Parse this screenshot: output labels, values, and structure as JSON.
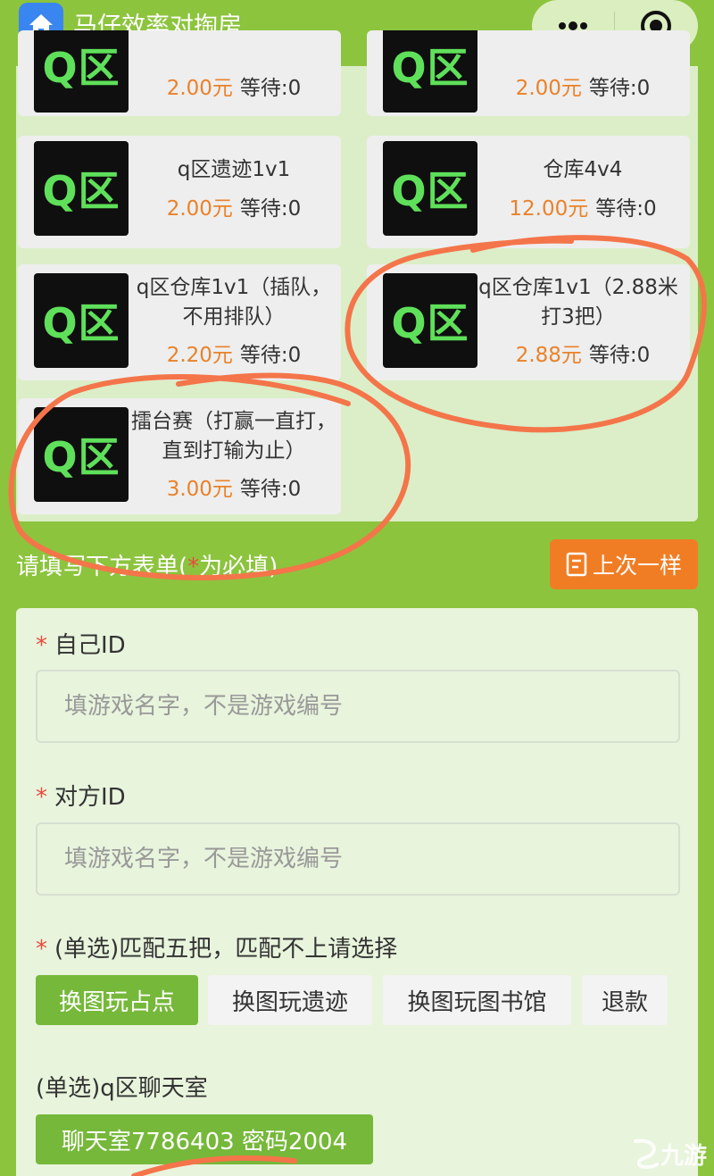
{
  "header": {
    "title": "马仔效率对掏房",
    "more_icon": "more-icon",
    "close_icon": "record-close-icon"
  },
  "products": [
    {
      "name": "",
      "price": "2.00元",
      "wait": "等待:0",
      "thumb": "Q区"
    },
    {
      "name": "",
      "price": "2.00元",
      "wait": "等待:0",
      "thumb": "Q区"
    },
    {
      "name": "q区遗迹1v1",
      "price": "2.00元",
      "wait": "等待:0",
      "thumb": "Q区"
    },
    {
      "name": "仓库4v4",
      "price": "12.00元",
      "wait": "等待:0",
      "thumb": "Q区"
    },
    {
      "name": "q区仓库1v1（插队，不用排队）",
      "price": "2.20元",
      "wait": "等待:0",
      "thumb": "Q区"
    },
    {
      "name": "q区仓库1v1（2.88米打3把）",
      "price": "2.88元",
      "wait": "等待:0",
      "thumb": "Q区"
    },
    {
      "name": "擂台赛（打赢一直打，直到打输为止）",
      "price": "3.00元",
      "wait": "等待:0",
      "thumb": "Q区"
    }
  ],
  "form_hint": {
    "prefix": "请填写下方表单(",
    "star": "*",
    "suffix": "为必填)"
  },
  "same_as_last_button": "上次一样",
  "form": {
    "self_id": {
      "label": "自己ID",
      "placeholder": "填游戏名字，不是游戏编号"
    },
    "opponent_id": {
      "label": "对方ID",
      "placeholder": "填游戏名字，不是游戏编号"
    },
    "match_choice": {
      "label": "(单选)匹配五把，匹配不上请选择",
      "options": [
        "换图玩占点",
        "换图玩遗迹",
        "换图玩图书馆",
        "退款"
      ],
      "selected": "换图玩占点"
    },
    "chat_room": {
      "label": "(单选)q区聊天室",
      "options": [
        "聊天室7786403 密码2004"
      ],
      "selected": "聊天室7786403 密码2004"
    }
  },
  "watermark": "九游",
  "colors": {
    "background": "#8cc43e",
    "accent_orange": "#f07d24",
    "price": "#e9822a",
    "selected_chip": "#76b83a",
    "annotation_stroke": "#f4754a"
  }
}
